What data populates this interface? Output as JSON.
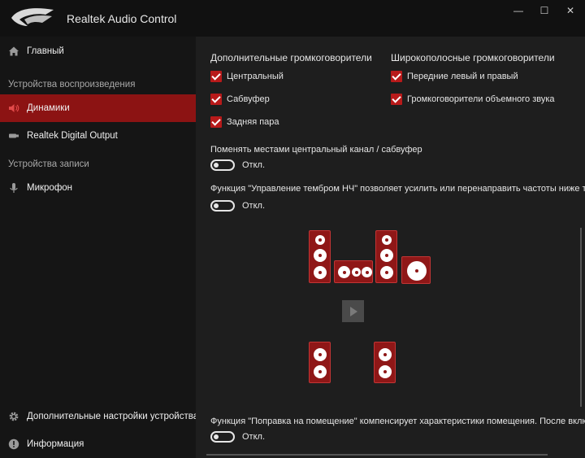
{
  "window": {
    "title": "Realtek Audio Control",
    "controls": {
      "minimize": "—",
      "maximize": "☐",
      "close": "✕"
    }
  },
  "sidebar": {
    "home": {
      "label": "Главный",
      "icon": "home-icon"
    },
    "playback_section": "Устройства воспроизведения",
    "speakers": {
      "label": "Динамики",
      "icon": "speaker-icon"
    },
    "digital_output": {
      "label": "Realtek Digital Output",
      "icon": "digital-output-icon"
    },
    "recording_section": "Устройства записи",
    "microphone": {
      "label": "Микрофон",
      "icon": "microphone-icon"
    },
    "advanced": {
      "label": "Дополнительные настройки устройства",
      "icon": "gear-icon"
    },
    "info": {
      "label": "Информация",
      "icon": "info-icon"
    }
  },
  "main": {
    "extra_speakers": {
      "title": "Дополнительные громкоговорители",
      "items": [
        {
          "label": "Центральный",
          "checked": true
        },
        {
          "label": "Сабвуфер",
          "checked": true
        },
        {
          "label": "Задняя пара",
          "checked": true
        }
      ]
    },
    "fullrange": {
      "title": "Широкополосные громкоговорители",
      "items": [
        {
          "label": "Передние левый и правый",
          "checked": true
        },
        {
          "label": "Громкоговорители объемного звука",
          "checked": true
        }
      ]
    },
    "swap": {
      "text": "Поменять местами центральный канал / сабвуфер",
      "state": "Откл."
    },
    "bass": {
      "text": "Функция \"Управление тембром НЧ\" позволяет усилить или перенаправить частоты ниже точки",
      "state": "Откл."
    },
    "room": {
      "text": "Функция \"Поправка на помещение\" компенсирует характеристики помещения. После включения",
      "state": "Откл."
    }
  },
  "colors": {
    "accent": "#8c1313",
    "checkbox": "#b81a1a",
    "speaker": "#8f1717"
  }
}
